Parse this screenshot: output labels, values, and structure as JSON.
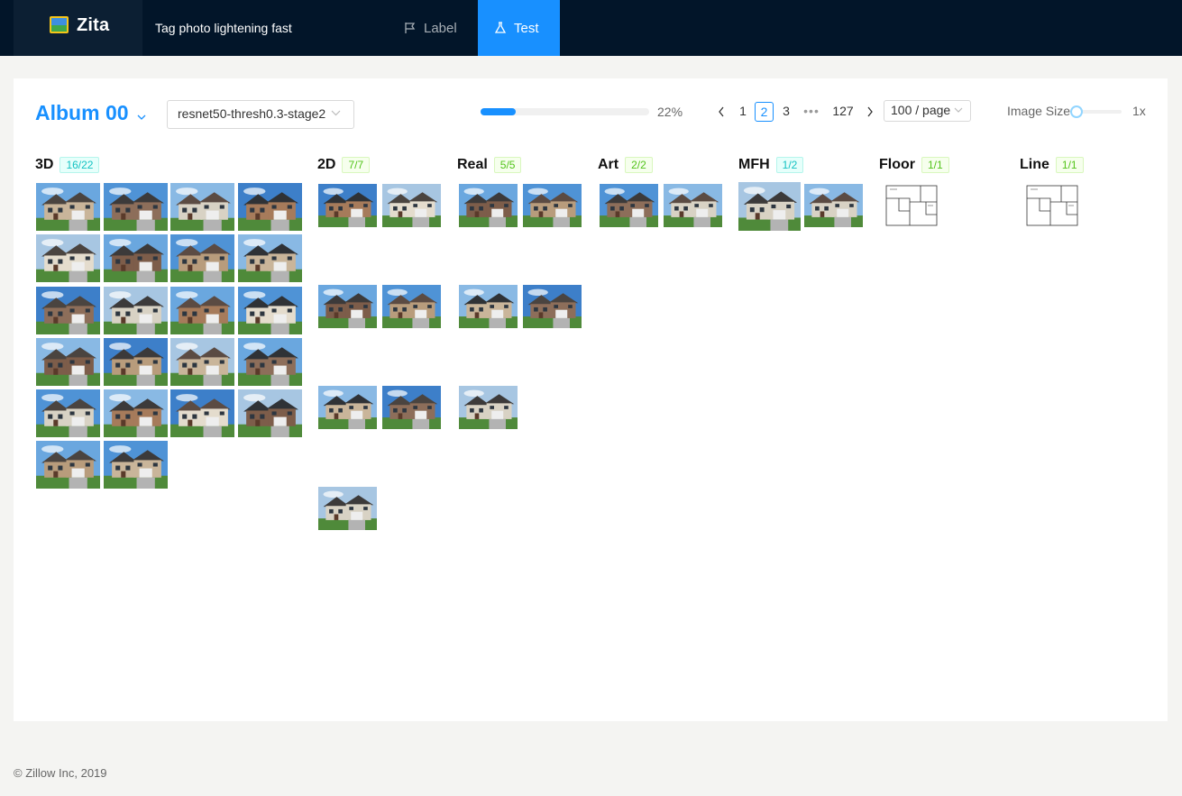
{
  "header": {
    "brand": "Zita",
    "tagline": "Tag photo lightening fast",
    "nav": [
      {
        "label": "Label",
        "icon": "flag-icon",
        "active": false
      },
      {
        "label": "Test",
        "icon": "flask-icon",
        "active": true
      }
    ]
  },
  "toolbar": {
    "album": "Album 00",
    "model_select": "resnet50-thresh0.3-stage2",
    "progress_percent": 22,
    "progress_text": "22%",
    "pagination": {
      "pages": [
        "1",
        "2",
        "3",
        "127"
      ],
      "current": "2",
      "ellipsis": "•••",
      "page_size": "100 / page"
    },
    "image_size_label": "Image Size",
    "image_size_value": "1x"
  },
  "columns": [
    {
      "title": "3D",
      "count": "16/22",
      "badge": "cyan"
    },
    {
      "title": "2D",
      "count": "7/7",
      "badge": "green"
    },
    {
      "title": "Real",
      "count": "5/5",
      "badge": "green"
    },
    {
      "title": "Art",
      "count": "2/2",
      "badge": "green"
    },
    {
      "title": "MFH",
      "count": "1/2",
      "badge": "cyan"
    },
    {
      "title": "Floor",
      "count": "1/1",
      "badge": "green"
    },
    {
      "title": "Line",
      "count": "1/1",
      "badge": "green"
    }
  ],
  "colors": {
    "accent": "#1890ff",
    "header_bg": "#021529",
    "selected_outline": "#e8645a"
  },
  "footer": "© Zillow Inc, 2019"
}
